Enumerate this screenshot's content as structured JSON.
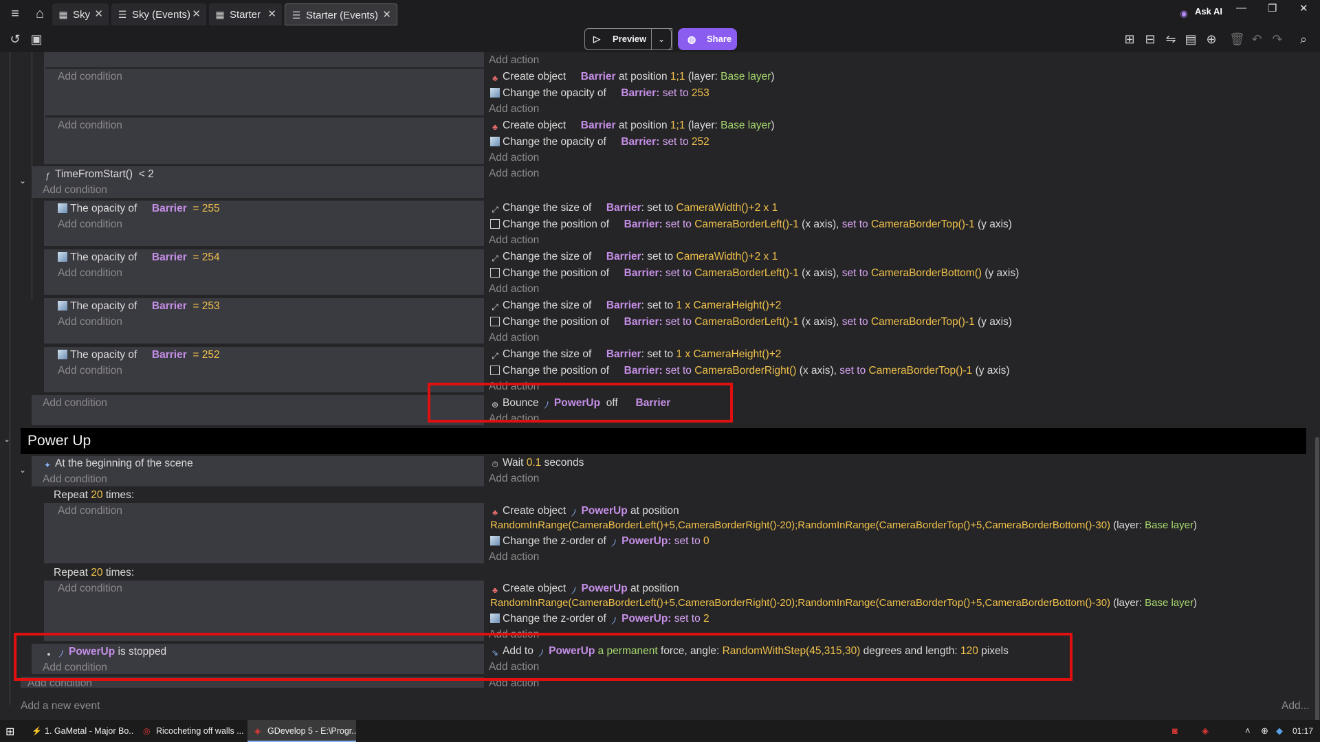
{
  "titlebar": {
    "tabs": [
      {
        "label": "Sky"
      },
      {
        "label": "Sky (Events)"
      },
      {
        "label": "Starter"
      },
      {
        "label": "Starter (Events)"
      }
    ],
    "ask_ai": "Ask AI"
  },
  "toolbar": {
    "preview_label": "Preview",
    "share_label": "Share"
  },
  "sheet": {
    "top_add_action": "Add action",
    "block1": {
      "add_condition": "Add condition",
      "action1": {
        "verb": "Create object",
        "obj": "Barrier",
        "mid": "at position",
        "pos": "1;1",
        "layer_open": "(layer:",
        "layer": "Base layer",
        "layer_close": ")"
      },
      "action2": {
        "verb": "Change the opacity of",
        "obj": "Barrier",
        "colon": ":",
        "kw": "set to",
        "val": "253"
      },
      "add_action": "Add action"
    },
    "block2": {
      "add_condition": "Add condition",
      "action1": {
        "verb": "Create object",
        "obj": "Barrier",
        "mid": "at position",
        "pos": "1;1",
        "layer_open": "(layer:",
        "layer": "Base layer",
        "layer_close": ")"
      },
      "action2": {
        "verb": "Change the opacity of",
        "obj": "Barrier",
        "colon": ":",
        "kw": "set to",
        "val": "252"
      },
      "add_action": "Add action"
    },
    "timer_event": {
      "condition": "TimeFromStart()",
      "op": "< 2",
      "add_condition": "Add condition",
      "add_action": "Add action"
    },
    "sub_events": [
      {
        "cond_label": "The opacity of",
        "cond_obj": "Barrier",
        "cond_op": "= 255",
        "add_condition": "Add condition",
        "a1_verb": "Change the size of",
        "a1_obj": "Barrier",
        "a1_mid": ": set to",
        "a1_expr": "CameraWidth()+2 x 1",
        "a2_verb": "Change the position of",
        "a2_obj": "Barrier",
        "a2_colon": ":",
        "a2_kw1": "set to",
        "a2_expr1": "CameraBorderLeft()-1",
        "a2_axis1": "(x axis),",
        "a2_kw2": "set to",
        "a2_expr2": "CameraBorderTop()-1",
        "a2_axis2": "(y axis)",
        "add_action": "Add action"
      },
      {
        "cond_label": "The opacity of",
        "cond_obj": "Barrier",
        "cond_op": "= 254",
        "add_condition": "Add condition",
        "a1_verb": "Change the size of",
        "a1_obj": "Barrier",
        "a1_mid": ": set to",
        "a1_expr": "CameraWidth()+2 x 1",
        "a2_verb": "Change the position of",
        "a2_obj": "Barrier",
        "a2_colon": ":",
        "a2_kw1": "set to",
        "a2_expr1": "CameraBorderLeft()-1",
        "a2_axis1": "(x axis),",
        "a2_kw2": "set to",
        "a2_expr2": "CameraBorderBottom()",
        "a2_axis2": "(y axis)",
        "add_action": "Add action"
      },
      {
        "cond_label": "The opacity of",
        "cond_obj": "Barrier",
        "cond_op": "= 253",
        "add_condition": "Add condition",
        "a1_verb": "Change the size of",
        "a1_obj": "Barrier",
        "a1_mid": ": set to",
        "a1_expr": "1 x CameraHeight()+2",
        "a2_verb": "Change the position of",
        "a2_obj": "Barrier",
        "a2_colon": ":",
        "a2_kw1": "set to",
        "a2_expr1": "CameraBorderLeft()-1",
        "a2_axis1": "(x axis),",
        "a2_kw2": "set to",
        "a2_expr2": "CameraBorderTop()-1",
        "a2_axis2": "(y axis)",
        "add_action": "Add action"
      },
      {
        "cond_label": "The opacity of",
        "cond_obj": "Barrier",
        "cond_op": "= 252",
        "add_condition": "Add condition",
        "a1_verb": "Change the size of",
        "a1_obj": "Barrier",
        "a1_mid": ": set to",
        "a1_expr": "1 x CameraHeight()+2",
        "a2_verb": "Change the position of",
        "a2_obj": "Barrier",
        "a2_colon": ":",
        "a2_kw1": "set to",
        "a2_expr1": "CameraBorderRight()",
        "a2_axis1": "(x axis),",
        "a2_kw2": "set to",
        "a2_expr2": "CameraBorderTop()-1",
        "a2_axis2": "(y axis)",
        "add_action": "Add action"
      }
    ],
    "bounce_event": {
      "add_condition": "Add condition",
      "verb": "Bounce",
      "obj1": "PowerUp",
      "mid": "off",
      "obj2": "Barrier",
      "add_action": "Add action"
    },
    "group": {
      "title": "Power Up"
    },
    "scene_event": {
      "condition": "At the beginning of the scene",
      "add_condition": "Add condition",
      "action_verb": "Wait",
      "action_val": "0.1",
      "action_unit": "seconds",
      "add_action": "Add action"
    },
    "repeats": [
      {
        "label_pre": "Repeat",
        "count": "20",
        "label_post": "times:",
        "add_condition": "Add condition",
        "a1_verb": "Create object",
        "a1_obj": "PowerUp",
        "a1_mid": "at position",
        "a1_expr": "RandomInRange(CameraBorderLeft()+5,CameraBorderRight()-20);RandomInRange(CameraBorderTop()+5,CameraBorderBottom()-30)",
        "a1_layer_open": "(layer:",
        "a1_layer": "Base layer",
        "a1_layer_close": ")",
        "a2_verb": "Change the z-order of",
        "a2_obj": "PowerUp",
        "a2_colon": ":",
        "a2_kw": "set to",
        "a2_val": "0",
        "add_action": "Add action"
      },
      {
        "label_pre": "Repeat",
        "count": "20",
        "label_post": "times:",
        "add_condition": "Add condition",
        "a1_verb": "Create object",
        "a1_obj": "PowerUp",
        "a1_mid": "at position",
        "a1_expr": "RandomInRange(CameraBorderLeft()+5,CameraBorderRight()-20);RandomInRange(CameraBorderTop()+5,CameraBorderBottom()-30)",
        "a1_layer_open": "(layer:",
        "a1_layer": "Base layer",
        "a1_layer_close": ")",
        "a2_verb": "Change the z-order of",
        "a2_obj": "PowerUp",
        "a2_colon": ":",
        "a2_kw": "set to",
        "a2_val": "2",
        "add_action": "Add action"
      }
    ],
    "stopped_event": {
      "obj": "PowerUp",
      "cond": "is stopped",
      "add_condition": "Add condition",
      "verb": "Add to",
      "a_obj": "PowerUp",
      "kw": "a permanent",
      "mid": "force, angle:",
      "expr": "RandomWithStep(45,315,30)",
      "mid2": "degrees and length:",
      "val": "120",
      "unit": "pixels",
      "add_action": "Add action"
    },
    "outer_add_condition": "Add condition",
    "outer_add_action": "Add action",
    "add_event": "Add a new event",
    "add_more": "Add..."
  },
  "taskbar": {
    "tasks": [
      {
        "label": "1. GaMetal - Major Bo..."
      },
      {
        "label": "Ricocheting off walls ..."
      },
      {
        "label": "GDevelop 5 - E:\\Progr..."
      }
    ],
    "clock": "01:17"
  }
}
